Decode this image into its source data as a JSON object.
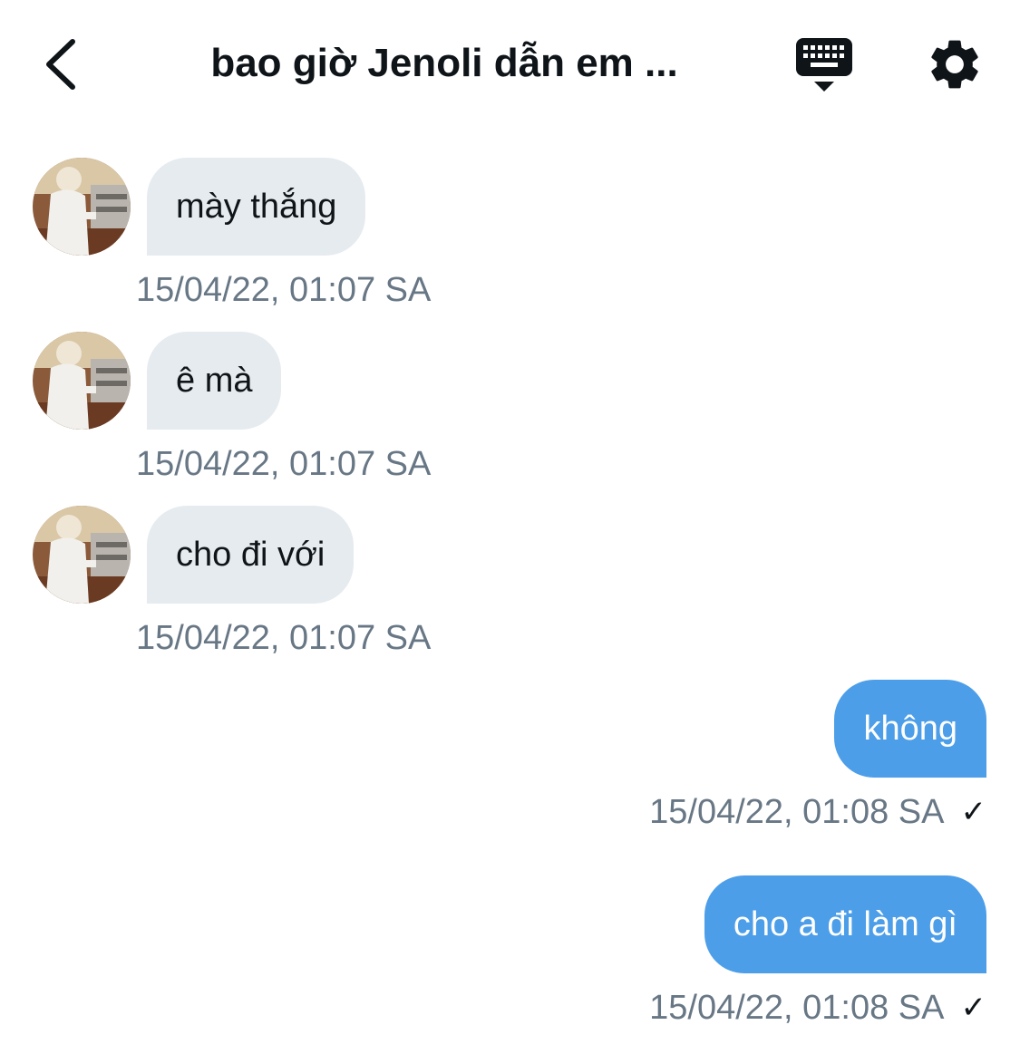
{
  "header": {
    "title": "bao giờ Jenoli dẫn em ...",
    "back_icon": "chevron-left-icon",
    "keyboard_icon": "keyboard-icon",
    "settings_icon": "gear-icon"
  },
  "messages": [
    {
      "direction": "incoming",
      "text": "mày thắng",
      "time": "15/04/22, 01:07 SA"
    },
    {
      "direction": "incoming",
      "text": "ê mà",
      "time": "15/04/22, 01:07 SA"
    },
    {
      "direction": "incoming",
      "text": "cho đi với",
      "time": "15/04/22, 01:07 SA"
    },
    {
      "direction": "outgoing",
      "text": "không",
      "time": "15/04/22, 01:08 SA",
      "status": "✓"
    },
    {
      "direction": "outgoing",
      "text": "cho a đi làm gì",
      "time": "15/04/22, 01:08 SA",
      "status": "✓"
    }
  ],
  "colors": {
    "incoming_bubble": "#e6ebef",
    "outgoing_bubble": "#4c9ee9",
    "timestamp": "#687785"
  }
}
